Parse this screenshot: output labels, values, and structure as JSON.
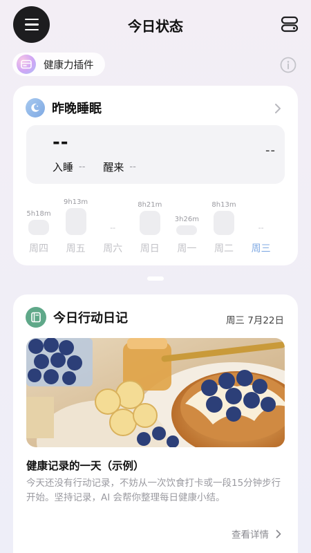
{
  "header": {
    "title": "今日状态",
    "menu_icon": "hamburger-menu-icon",
    "layout_icon": "widget-layout-icon"
  },
  "plugin": {
    "label": "健康力插件",
    "icon": "plugin-card-icon",
    "info_icon": "info-icon"
  },
  "sleep": {
    "title": "昨晚睡眠",
    "icon": "moon-icon",
    "duration": "--",
    "score": "--",
    "sleep_label": "入睡",
    "sleep_value": "--",
    "wake_label": "醒来",
    "wake_value": "--",
    "days": [
      {
        "name": "周四",
        "duration": "5h18m",
        "hours": 5.3,
        "today": false
      },
      {
        "name": "周五",
        "duration": "9h13m",
        "hours": 9.22,
        "today": false
      },
      {
        "name": "周六",
        "duration": "--",
        "hours": null,
        "today": false
      },
      {
        "name": "周日",
        "duration": "8h21m",
        "hours": 8.35,
        "today": false
      },
      {
        "name": "周一",
        "duration": "3h26m",
        "hours": 3.43,
        "today": false
      },
      {
        "name": "周二",
        "duration": "8h13m",
        "hours": 8.22,
        "today": false
      },
      {
        "name": "周三",
        "duration": "--",
        "hours": null,
        "today": true
      }
    ]
  },
  "diary": {
    "title": "今日行动日记",
    "icon": "diary-book-icon",
    "date": "周三 7月22日",
    "entry_title": "健康记录的一天（示例）",
    "entry_desc": "今天还没有行动记录，不妨从一次饮食打卡或一段15分钟步行开始。坚持记录，AI 会帮你整理每日健康小结。",
    "detail_label": "查看详情"
  },
  "colors": {
    "accent_blue": "#7fa9e3",
    "diary_green": "#5fa889",
    "menu_dark": "#1d1d1f"
  }
}
